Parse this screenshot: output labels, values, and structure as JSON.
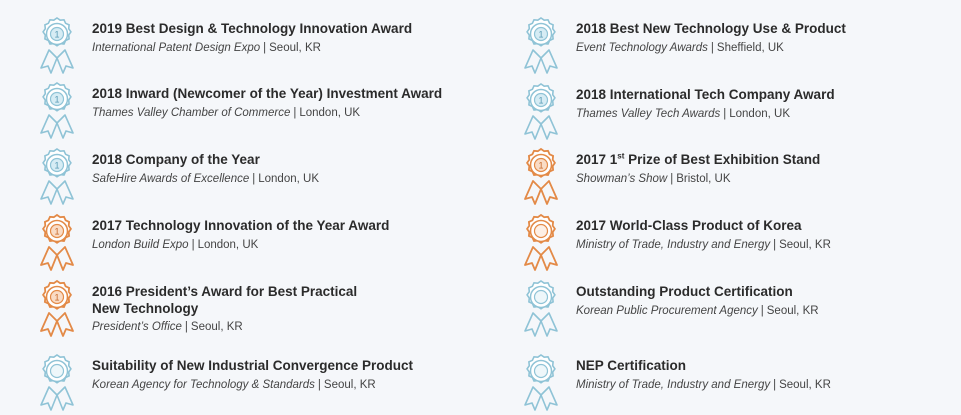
{
  "colors": {
    "blue_badge": "#8fc3d6",
    "orange_badge": "#e38a47",
    "title_text": "#2b2b2b",
    "sub_text": "#444444"
  },
  "left": [
    {
      "icon": "blue-medal-icon-numbered",
      "title": "2019 Best Design & Technology Innovation Award",
      "org": "International Patent Design Expo",
      "location": "Seoul, KR"
    },
    {
      "icon": "blue-medal-icon-numbered",
      "title": "2018 Inward (Newcomer of the Year) Investment Award",
      "org": "Thames Valley Chamber of Commerce",
      "location": "London, UK"
    },
    {
      "icon": "blue-medal-icon-numbered",
      "title": "2018 Company of the Year",
      "org": "SafeHire Awards of Excellence",
      "location": "London, UK"
    },
    {
      "icon": "orange-medal-icon-numbered",
      "title": "2017 Technology Innovation of the Year Award",
      "org": "London Build Expo",
      "location": "London, UK"
    },
    {
      "icon": "orange-medal-icon-numbered",
      "title": "2016 President’s Award for Best Practical New Technology",
      "org": "President’s Office",
      "location": "Seoul, KR"
    },
    {
      "icon": "blue-medal-icon-plain",
      "title": "Suitability of New Industrial Convergence Product",
      "org": "Korean Agency for Technology & Standards",
      "location": "Seoul, KR"
    }
  ],
  "right": [
    {
      "icon": "blue-medal-icon-numbered",
      "title": "2018 Best New Technology Use & Product",
      "org": "Event Technology Awards",
      "location": "Sheffield, UK"
    },
    {
      "icon": "blue-medal-icon-numbered",
      "title": "2018 International Tech Company Award",
      "org": "Thames Valley Tech Awards",
      "location": "London, UK"
    },
    {
      "icon": "orange-medal-icon-numbered",
      "title_pre": "2017 1",
      "title_sup": "st",
      "title_post": " Prize of Best Exhibition Stand",
      "org": "Showman’s Show",
      "location": "Bristol, UK"
    },
    {
      "icon": "orange-medal-icon-plain",
      "title": "2017 World-Class Product of Korea",
      "org": "Ministry of Trade, Industry and Energy",
      "location": "Seoul, KR"
    },
    {
      "icon": "blue-medal-icon-plain",
      "title": "Outstanding Product Certification",
      "org": "Korean Public Procurement Agency",
      "location": "Seoul, KR"
    },
    {
      "icon": "blue-medal-icon-plain",
      "title": "NEP Certification",
      "org": "Ministry of Trade, Industry and Energy",
      "location": "Seoul, KR"
    }
  ]
}
